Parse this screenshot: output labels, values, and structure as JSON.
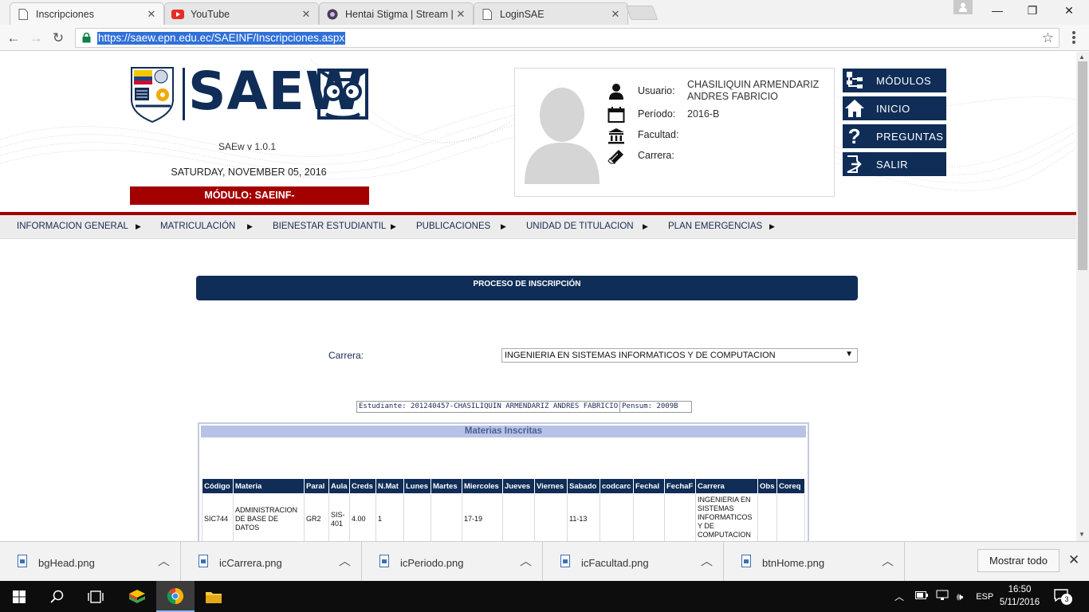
{
  "browser": {
    "tabs": [
      {
        "title": "Inscripciones",
        "icon": "page-icon",
        "active": true
      },
      {
        "title": "YouTube",
        "icon": "youtube-icon",
        "active": false
      },
      {
        "title": "Hentai Stigma | Stream |",
        "icon": "stream-site-icon",
        "active": false
      },
      {
        "title": "LoginSAE",
        "icon": "page-icon",
        "active": false
      }
    ],
    "close_glyph": "✕",
    "url": "https://saew.epn.edu.ec/SAEINF/Inscripciones.aspx"
  },
  "header": {
    "logo_text": "SAEW",
    "version": "SAEw v 1.0.1",
    "date": "SATURDAY, NOVEMBER 05, 2016",
    "module": "MÓDULO: SAEINF-"
  },
  "user": {
    "usuario_label": "Usuario:",
    "usuario_value": "CHASILIQUIN ARMENDARIZ ANDRES FABRICIO",
    "periodo_label": "Período:",
    "periodo_value": "2016-B",
    "facultad_label": "Facultad:",
    "facultad_value": "",
    "carrera_label": "Carrera:",
    "carrera_value": ""
  },
  "side_buttons": {
    "modulos": "MÓDULOS",
    "inicio": "INICIO",
    "preguntas": "PREGUNTAS",
    "salir": "SALIR"
  },
  "menu": [
    "INFORMACION GENERAL",
    "MATRICULACIÓN",
    "BIENESTAR ESTUDIANTIL",
    "PUBLICACIONES",
    "UNIDAD DE TITULACION",
    "PLAN EMERGENCIAS"
  ],
  "main": {
    "proceso_title": "PROCESO DE INSCRIPCIÓN",
    "carrera_label": "Carrera:",
    "carrera_selected": "INGENIERIA EN SISTEMAS INFORMATICOS Y DE COMPUTACION",
    "estudiante": "Estudiante: 201240457-CHASILIQUIN ARMENDARIZ ANDRES FABRICIO",
    "pensum": "Pensum: 2009B",
    "materias_title": "Materias Inscritas",
    "columns": [
      "Código",
      "Materia",
      "Paral",
      "Aula",
      "Creds",
      "N.Mat",
      "Lunes",
      "Martes",
      "Miercoles",
      "Jueves",
      "Viernes",
      "Sabado",
      "codcarc",
      "FechaI",
      "FechaF",
      "Carrera",
      "Obs",
      "Coreq"
    ],
    "rows": [
      {
        "codigo": "SIC744",
        "materia": "ADMINISTRACION DE BASE DE DATOS",
        "paral": "GR2",
        "aula": "SIS-401",
        "creds": "4.00",
        "nmat": "1",
        "lunes": "",
        "martes": "",
        "miercoles": "17-19",
        "jueves": "",
        "viernes": "",
        "sabado": "11-13",
        "codcarc": "",
        "fechai": "",
        "fechaf": "",
        "carrera": "INGENIERIA EN SISTEMAS INFORMATICOS Y DE COMPUTACION",
        "obs": "",
        "coreq": ""
      }
    ]
  },
  "downloads": {
    "items": [
      "bgHead.png",
      "icCarrera.png",
      "icPeriodo.png",
      "icFacultad.png",
      "btnHome.png"
    ],
    "show_all": "Mostrar todo"
  },
  "taskbar": {
    "lang": "ESP",
    "time": "16:50",
    "date": "5/11/2016",
    "notifications": "3"
  },
  "colors": {
    "navy": "#0f2d57",
    "red": "#a30000",
    "table_header": "#b7c3e6"
  }
}
